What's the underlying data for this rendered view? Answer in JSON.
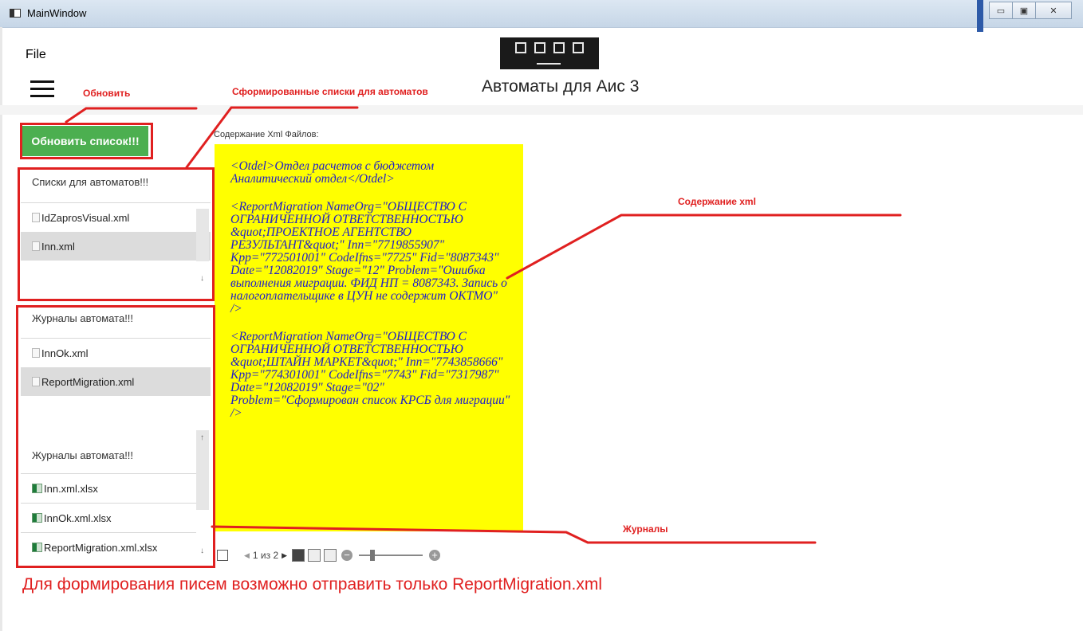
{
  "window": {
    "title": "MainWindow",
    "controls": [
      "minimize-icon",
      "maximize-icon",
      "close-icon"
    ],
    "close_glyph": "✕",
    "minimize_glyph": "▭",
    "maximize_glyph": "▣"
  },
  "menu": {
    "file_label": "File"
  },
  "header": {
    "title": "Автоматы для Аис 3"
  },
  "refresh_button_label": "Обновить список!!!",
  "lists_panel": {
    "header": "Списки для автоматов!!!",
    "items": [
      {
        "label": "IdZaprosVisual.xml",
        "selected": false
      },
      {
        "label": "Inn.xml",
        "selected": true
      }
    ]
  },
  "journals_panel": {
    "header": "Журналы автомата!!!",
    "items": [
      {
        "label": "InnOk.xml",
        "selected": false
      },
      {
        "label": "ReportMigration.xml",
        "selected": true
      }
    ]
  },
  "journals_xlsx_panel": {
    "header": "Журналы автомата!!!",
    "items": [
      {
        "label": "Inn.xml.xlsx"
      },
      {
        "label": "InnOk.xml.xlsx"
      },
      {
        "label": "ReportMigration.xml.xlsx"
      }
    ]
  },
  "xml_viewer": {
    "label": "Содержание Xml Файлов:",
    "paragraphs": [
      "<Otdel>Отдел расчетов с бюджетом Аналитический отдел</Otdel>",
      "<ReportMigration NameOrg=\"ОБЩЕСТВО С ОГРАНИЧЕННОЙ ОТВЕТСТВЕННОСТЬЮ &quot;ПРОЕКТНОЕ АГЕНТСТВО РЕЗУЛЬТАНТ&quot;\" Inn=\"7719855907\" Kpp=\"772501001\" CodeIfns=\"7725\" Fid=\"8087343\" Date=\"12082019\" Stage=\"12\" Problem=\"Ошибка выполнения миграции. ФИД НП = 8087343. Запись о налогоплательщике в ЦУН не содержит ОКТМО\" />",
      "<ReportMigration NameOrg=\"ОБЩЕСТВО С ОГРАНИЧЕННОЙ ОТВЕТСТВЕННОСТЬЮ &quot;ШТАЙН МАРКЕТ&quot;\" Inn=\"7743858666\" Kpp=\"774301001\" CodeIfns=\"7743\" Fid=\"7317987\" Date=\"12082019\" Stage=\"02\" Problem=\"Сформирован список КРСБ для миграции\" />"
    ],
    "pager_text": "1 из 2",
    "prev_glyph": "◀",
    "next_glyph": "▶",
    "minus_glyph": "−",
    "plus_glyph": "+",
    "search_icon": "search-icon"
  },
  "annotations": {
    "refresh": "Обновить",
    "lists": "Сформированные списки для автоматов",
    "xml_content": "Содержание xml",
    "journals": "Журналы",
    "bottom_note": "Для формирования писем возможно отправить только ReportMigration.xml"
  },
  "colors": {
    "annotation_red": "#e02020",
    "refresh_green": "#4caf50",
    "xml_background": "#ffff00",
    "xml_text": "#2020c8",
    "selected_item": "#dcdcdc"
  },
  "scroll_glyphs": {
    "up": "↑",
    "down": "↓"
  }
}
